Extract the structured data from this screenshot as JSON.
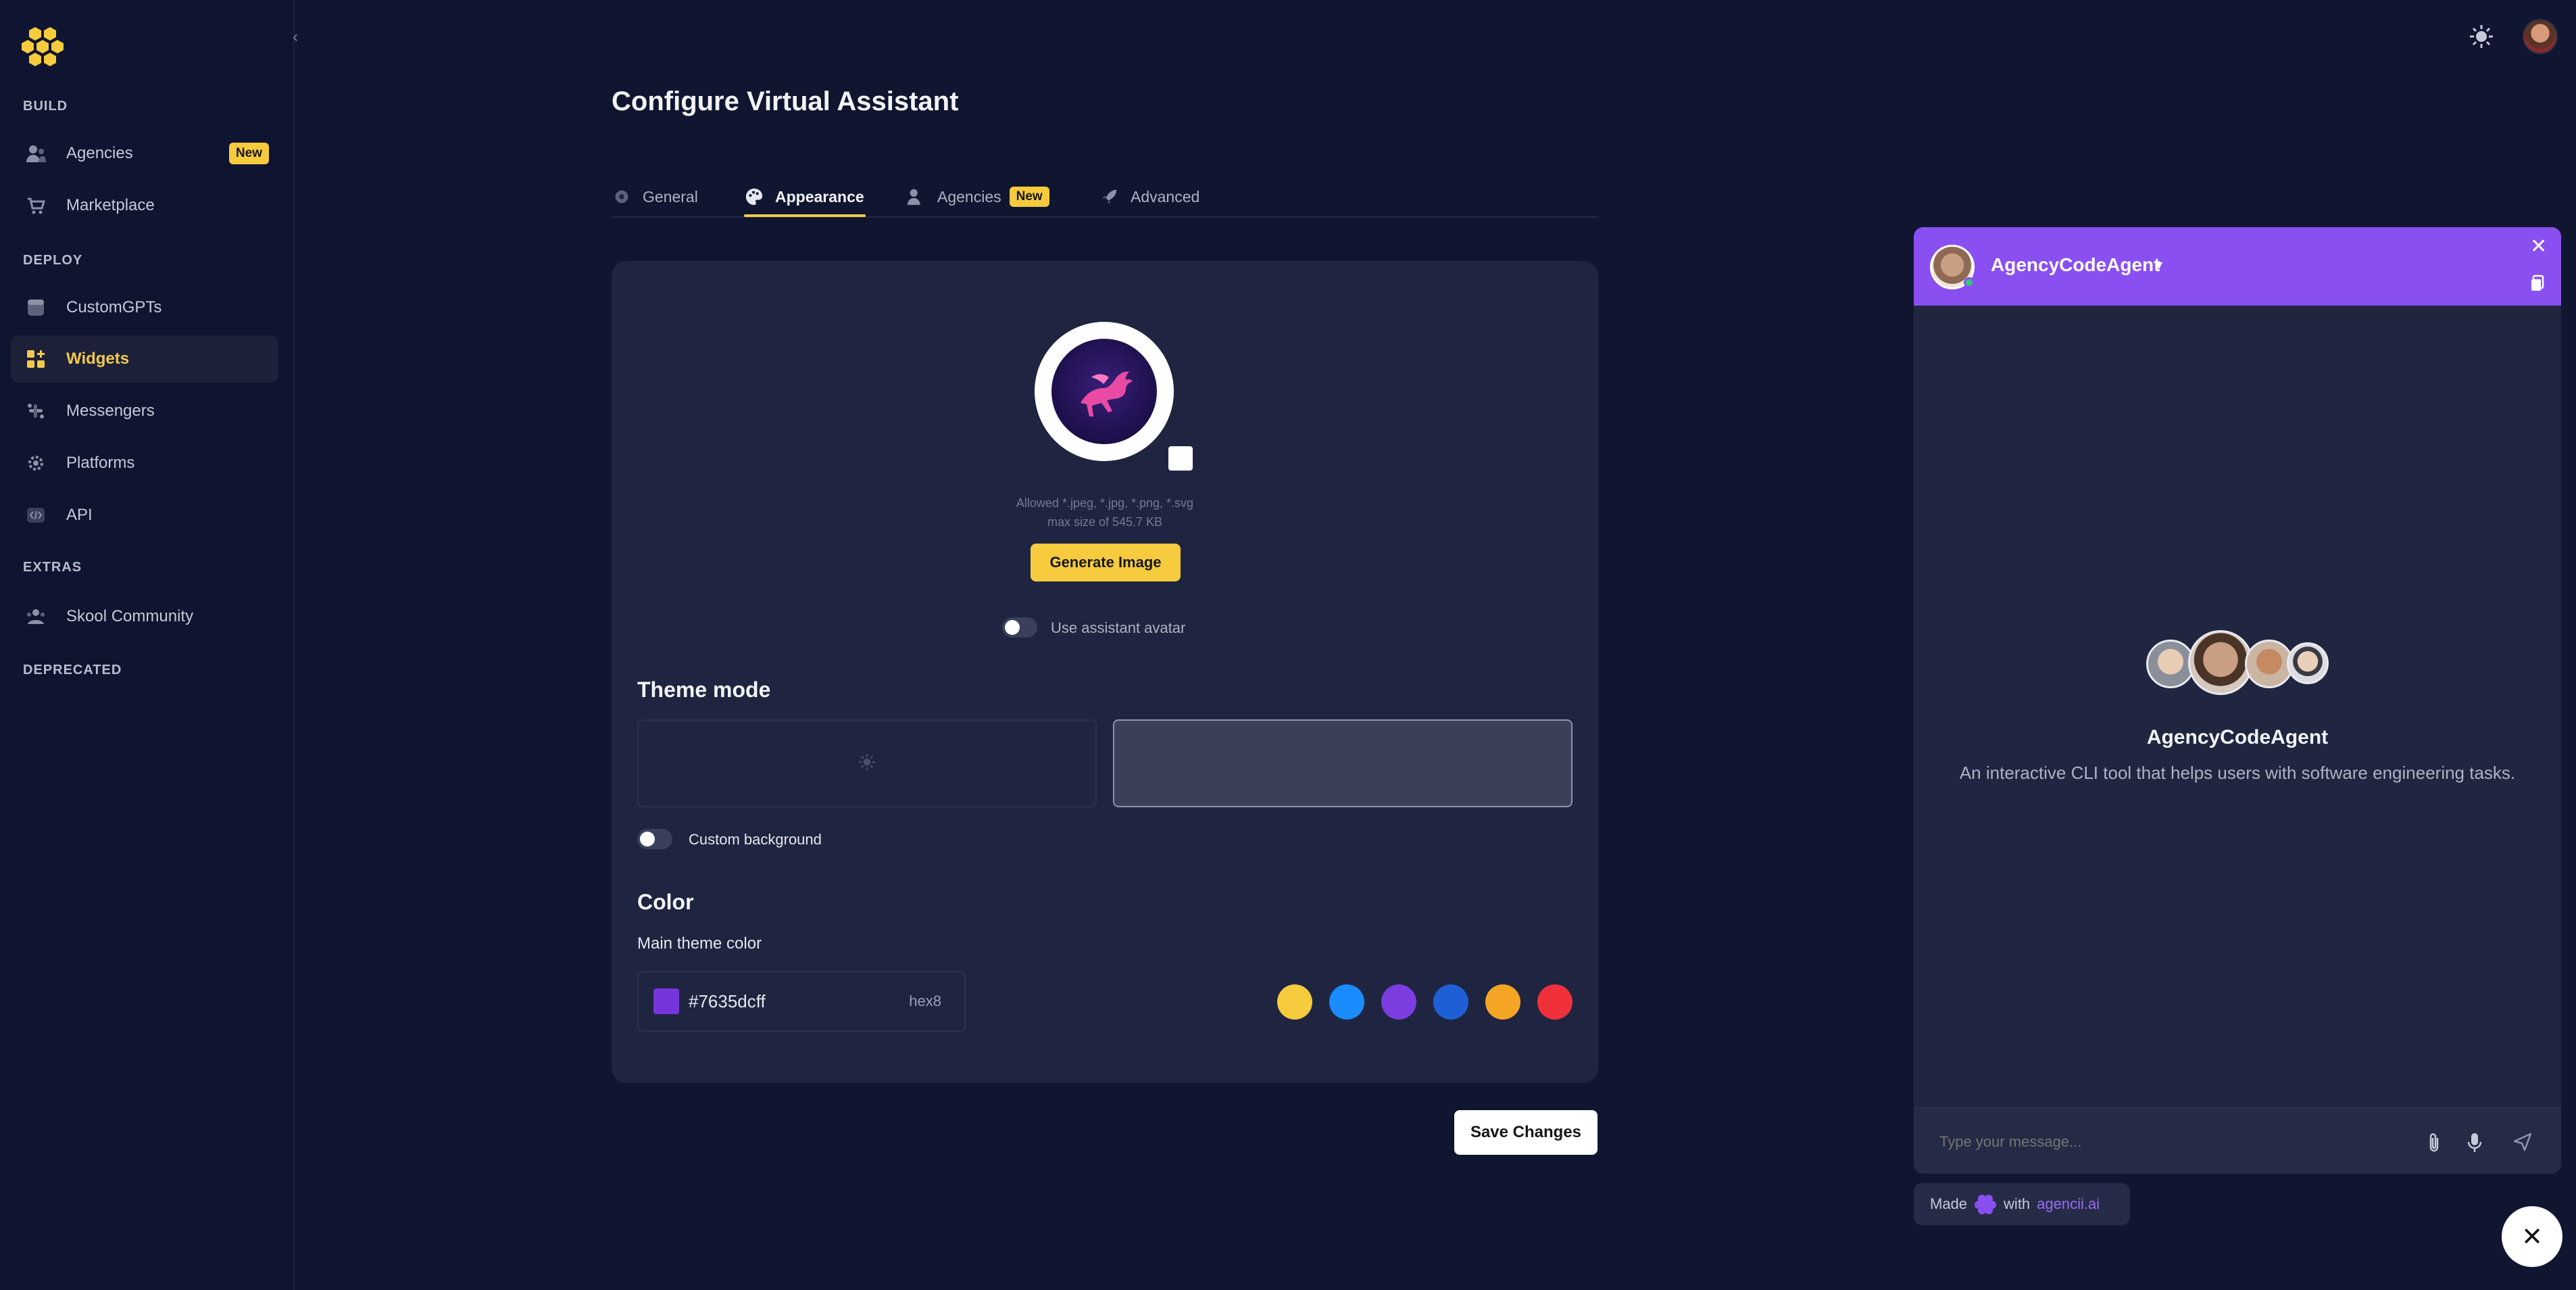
{
  "sidebar": {
    "sections": {
      "build": "BUILD",
      "deploy": "DEPLOY",
      "extras": "EXTRAS",
      "deprecated": "DEPRECATED"
    },
    "items": [
      {
        "label": "Agencies",
        "badge": "New",
        "icon": "users-icon"
      },
      {
        "label": "Marketplace",
        "icon": "cart-icon"
      },
      {
        "label": "CustomGPTs",
        "icon": "database-icon"
      },
      {
        "label": "Widgets",
        "icon": "widgets-icon",
        "active": true
      },
      {
        "label": "Messengers",
        "icon": "slack-icon"
      },
      {
        "label": "Platforms",
        "icon": "gear-icon"
      },
      {
        "label": "API",
        "icon": "code-icon"
      },
      {
        "label": "Skool Community",
        "icon": "community-icon"
      }
    ]
  },
  "page": {
    "title": "Configure Virtual Assistant",
    "tabs": [
      {
        "label": "General",
        "icon": "gear-icon"
      },
      {
        "label": "Appearance",
        "icon": "palette-icon",
        "active": true
      },
      {
        "label": "Agencies",
        "icon": "users-icon",
        "badge": "New"
      },
      {
        "label": "Advanced",
        "icon": "rocket-icon"
      }
    ]
  },
  "appearance": {
    "upload_hint_line1": "Allowed *.jpeg, *.jpg, *.png, *.svg",
    "upload_hint_line2": "max size of 545.7 KB",
    "generate_button": "Generate Image",
    "use_avatar_label": "Use assistant avatar",
    "theme_mode_heading": "Theme mode",
    "custom_background_label": "Custom background",
    "color_heading": "Color",
    "main_theme_color_label": "Main theme color",
    "color_value": "#7635dcff",
    "color_format": "hex8",
    "swatches": [
      "#f6cb3d",
      "#1a8cff",
      "#7b3ce0",
      "#1f5fd6",
      "#f5a524",
      "#f0313b"
    ],
    "save_button": "Save Changes"
  },
  "chat": {
    "agent_name": "AgencyCodeAgent",
    "description": "An interactive CLI tool that helps users with software engineering tasks.",
    "input_placeholder": "Type your message...",
    "header_color": "#8a4ff0"
  },
  "footer": {
    "made": "Made",
    "with": "with",
    "brand": "agencii.ai"
  }
}
